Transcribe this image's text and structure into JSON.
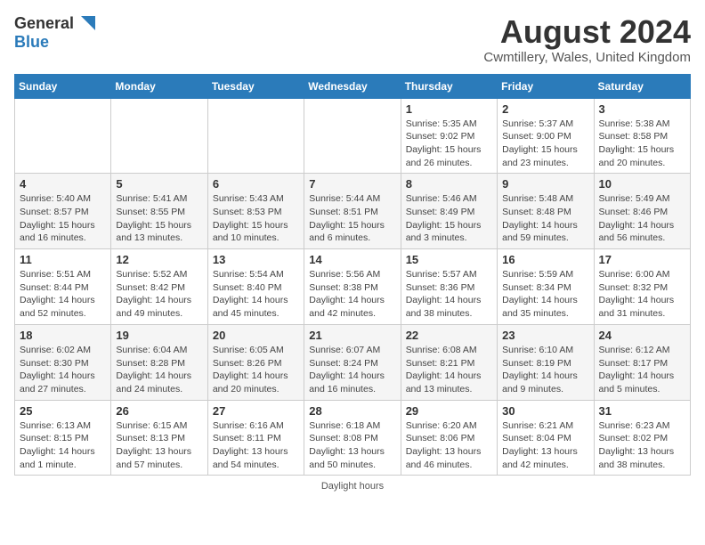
{
  "header": {
    "logo_general": "General",
    "logo_blue": "Blue",
    "month_title": "August 2024",
    "location": "Cwmtillery, Wales, United Kingdom"
  },
  "weekdays": [
    "Sunday",
    "Monday",
    "Tuesday",
    "Wednesday",
    "Thursday",
    "Friday",
    "Saturday"
  ],
  "footer": {
    "daylight_label": "Daylight hours"
  },
  "weeks": [
    [
      {
        "day": "",
        "sunrise": "",
        "sunset": "",
        "daylight": ""
      },
      {
        "day": "",
        "sunrise": "",
        "sunset": "",
        "daylight": ""
      },
      {
        "day": "",
        "sunrise": "",
        "sunset": "",
        "daylight": ""
      },
      {
        "day": "",
        "sunrise": "",
        "sunset": "",
        "daylight": ""
      },
      {
        "day": "1",
        "sunrise": "Sunrise: 5:35 AM",
        "sunset": "Sunset: 9:02 PM",
        "daylight": "Daylight: 15 hours and 26 minutes."
      },
      {
        "day": "2",
        "sunrise": "Sunrise: 5:37 AM",
        "sunset": "Sunset: 9:00 PM",
        "daylight": "Daylight: 15 hours and 23 minutes."
      },
      {
        "day": "3",
        "sunrise": "Sunrise: 5:38 AM",
        "sunset": "Sunset: 8:58 PM",
        "daylight": "Daylight: 15 hours and 20 minutes."
      }
    ],
    [
      {
        "day": "4",
        "sunrise": "Sunrise: 5:40 AM",
        "sunset": "Sunset: 8:57 PM",
        "daylight": "Daylight: 15 hours and 16 minutes."
      },
      {
        "day": "5",
        "sunrise": "Sunrise: 5:41 AM",
        "sunset": "Sunset: 8:55 PM",
        "daylight": "Daylight: 15 hours and 13 minutes."
      },
      {
        "day": "6",
        "sunrise": "Sunrise: 5:43 AM",
        "sunset": "Sunset: 8:53 PM",
        "daylight": "Daylight: 15 hours and 10 minutes."
      },
      {
        "day": "7",
        "sunrise": "Sunrise: 5:44 AM",
        "sunset": "Sunset: 8:51 PM",
        "daylight": "Daylight: 15 hours and 6 minutes."
      },
      {
        "day": "8",
        "sunrise": "Sunrise: 5:46 AM",
        "sunset": "Sunset: 8:49 PM",
        "daylight": "Daylight: 15 hours and 3 minutes."
      },
      {
        "day": "9",
        "sunrise": "Sunrise: 5:48 AM",
        "sunset": "Sunset: 8:48 PM",
        "daylight": "Daylight: 14 hours and 59 minutes."
      },
      {
        "day": "10",
        "sunrise": "Sunrise: 5:49 AM",
        "sunset": "Sunset: 8:46 PM",
        "daylight": "Daylight: 14 hours and 56 minutes."
      }
    ],
    [
      {
        "day": "11",
        "sunrise": "Sunrise: 5:51 AM",
        "sunset": "Sunset: 8:44 PM",
        "daylight": "Daylight: 14 hours and 52 minutes."
      },
      {
        "day": "12",
        "sunrise": "Sunrise: 5:52 AM",
        "sunset": "Sunset: 8:42 PM",
        "daylight": "Daylight: 14 hours and 49 minutes."
      },
      {
        "day": "13",
        "sunrise": "Sunrise: 5:54 AM",
        "sunset": "Sunset: 8:40 PM",
        "daylight": "Daylight: 14 hours and 45 minutes."
      },
      {
        "day": "14",
        "sunrise": "Sunrise: 5:56 AM",
        "sunset": "Sunset: 8:38 PM",
        "daylight": "Daylight: 14 hours and 42 minutes."
      },
      {
        "day": "15",
        "sunrise": "Sunrise: 5:57 AM",
        "sunset": "Sunset: 8:36 PM",
        "daylight": "Daylight: 14 hours and 38 minutes."
      },
      {
        "day": "16",
        "sunrise": "Sunrise: 5:59 AM",
        "sunset": "Sunset: 8:34 PM",
        "daylight": "Daylight: 14 hours and 35 minutes."
      },
      {
        "day": "17",
        "sunrise": "Sunrise: 6:00 AM",
        "sunset": "Sunset: 8:32 PM",
        "daylight": "Daylight: 14 hours and 31 minutes."
      }
    ],
    [
      {
        "day": "18",
        "sunrise": "Sunrise: 6:02 AM",
        "sunset": "Sunset: 8:30 PM",
        "daylight": "Daylight: 14 hours and 27 minutes."
      },
      {
        "day": "19",
        "sunrise": "Sunrise: 6:04 AM",
        "sunset": "Sunset: 8:28 PM",
        "daylight": "Daylight: 14 hours and 24 minutes."
      },
      {
        "day": "20",
        "sunrise": "Sunrise: 6:05 AM",
        "sunset": "Sunset: 8:26 PM",
        "daylight": "Daylight: 14 hours and 20 minutes."
      },
      {
        "day": "21",
        "sunrise": "Sunrise: 6:07 AM",
        "sunset": "Sunset: 8:24 PM",
        "daylight": "Daylight: 14 hours and 16 minutes."
      },
      {
        "day": "22",
        "sunrise": "Sunrise: 6:08 AM",
        "sunset": "Sunset: 8:21 PM",
        "daylight": "Daylight: 14 hours and 13 minutes."
      },
      {
        "day": "23",
        "sunrise": "Sunrise: 6:10 AM",
        "sunset": "Sunset: 8:19 PM",
        "daylight": "Daylight: 14 hours and 9 minutes."
      },
      {
        "day": "24",
        "sunrise": "Sunrise: 6:12 AM",
        "sunset": "Sunset: 8:17 PM",
        "daylight": "Daylight: 14 hours and 5 minutes."
      }
    ],
    [
      {
        "day": "25",
        "sunrise": "Sunrise: 6:13 AM",
        "sunset": "Sunset: 8:15 PM",
        "daylight": "Daylight: 14 hours and 1 minute."
      },
      {
        "day": "26",
        "sunrise": "Sunrise: 6:15 AM",
        "sunset": "Sunset: 8:13 PM",
        "daylight": "Daylight: 13 hours and 57 minutes."
      },
      {
        "day": "27",
        "sunrise": "Sunrise: 6:16 AM",
        "sunset": "Sunset: 8:11 PM",
        "daylight": "Daylight: 13 hours and 54 minutes."
      },
      {
        "day": "28",
        "sunrise": "Sunrise: 6:18 AM",
        "sunset": "Sunset: 8:08 PM",
        "daylight": "Daylight: 13 hours and 50 minutes."
      },
      {
        "day": "29",
        "sunrise": "Sunrise: 6:20 AM",
        "sunset": "Sunset: 8:06 PM",
        "daylight": "Daylight: 13 hours and 46 minutes."
      },
      {
        "day": "30",
        "sunrise": "Sunrise: 6:21 AM",
        "sunset": "Sunset: 8:04 PM",
        "daylight": "Daylight: 13 hours and 42 minutes."
      },
      {
        "day": "31",
        "sunrise": "Sunrise: 6:23 AM",
        "sunset": "Sunset: 8:02 PM",
        "daylight": "Daylight: 13 hours and 38 minutes."
      }
    ]
  ]
}
